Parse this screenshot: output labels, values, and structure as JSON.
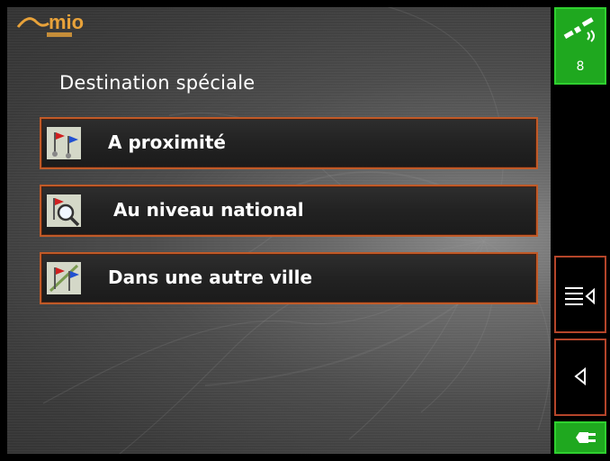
{
  "page": {
    "title": "Destination spéciale"
  },
  "brand": {
    "logo_text": "mio",
    "logo_color": "#e8a23a"
  },
  "menu": {
    "items": [
      {
        "id": "nearby",
        "label": "A proximité",
        "icon": "flags-icon"
      },
      {
        "id": "national",
        "label": "Au niveau national",
        "icon": "flag-search-icon"
      },
      {
        "id": "other_city",
        "label": "Dans une autre ville",
        "icon": "flags-route-icon"
      }
    ]
  },
  "sidebar": {
    "gps": {
      "satellite_count": "8",
      "icon": "satellite-icon"
    },
    "menu_button": {
      "icon": "menu-list-icon"
    },
    "back_button": {
      "icon": "back-arrow-icon"
    },
    "power": {
      "icon": "power-plug-icon"
    }
  },
  "colors": {
    "button_border": "#c05a28",
    "status_green": "#1fa81f",
    "side_border": "#b5452a"
  }
}
